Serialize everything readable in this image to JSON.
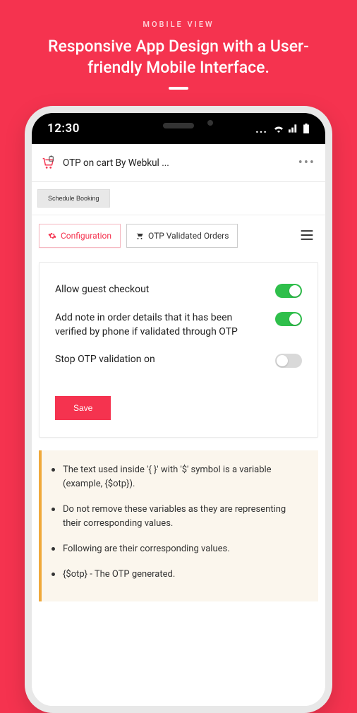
{
  "header": {
    "eyebrow": "MOBILE VIEW",
    "title": "Responsive App Design with a User-friendly Mobile Interface."
  },
  "status": {
    "time": "12:30"
  },
  "appbar": {
    "title": "OTP on cart By Webkul ..."
  },
  "ribbon": {
    "schedule_label": "Schedule Booking"
  },
  "tabs": {
    "configuration_label": "Configuration",
    "validated_label": "OTP Validated Orders"
  },
  "settings": {
    "rows": [
      {
        "label": "Allow guest checkout",
        "on": true
      },
      {
        "label": "Add note in order details that it has been verified by phone if validated through OTP",
        "on": true
      },
      {
        "label": "Stop OTP validation on",
        "on": false
      }
    ],
    "save_label": "Save"
  },
  "notes": {
    "items": [
      "The text used inside '{ }' with '$' symbol is a variable (example, {$otp}).",
      "Do not remove these variables as they are representing their corresponding values.",
      "Following are their corresponding values.",
      "{$otp} - The OTP generated."
    ]
  }
}
